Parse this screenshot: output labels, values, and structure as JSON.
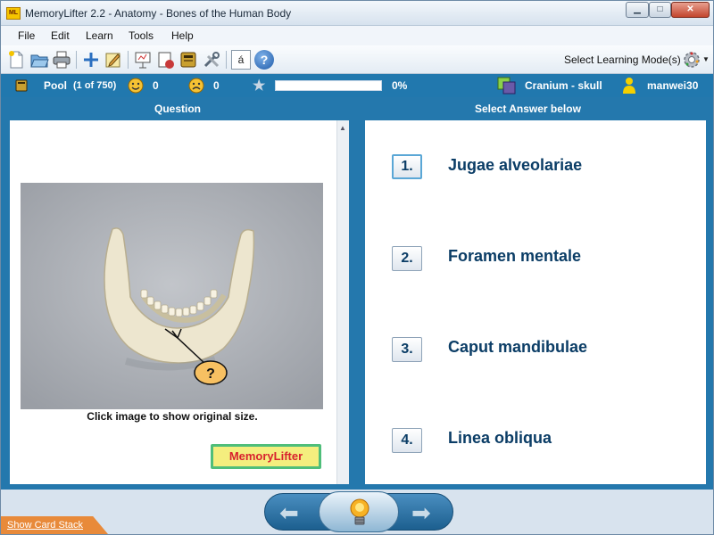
{
  "window": {
    "title": "MemoryLifter 2.2 - Anatomy - Bones of the Human Body",
    "app_icon_text": "ML"
  },
  "menu": [
    "File",
    "Edit",
    "Learn",
    "Tools",
    "Help"
  ],
  "toolbar": {
    "icons": [
      "new-document-icon",
      "open-folder-icon",
      "print-icon",
      "add-icon",
      "edit-card-icon",
      "presentation-icon",
      "print-cards-icon",
      "card-box-icon",
      "settings-tools-icon",
      "character-map-icon",
      "help-icon"
    ],
    "char_map_label": "á",
    "help_label": "?",
    "mode_label": "Select Learning Mode(s)"
  },
  "status": {
    "pool_label": "Pool",
    "pool_count": "(1 of 750)",
    "correct_count": "0",
    "wrong_count": "0",
    "progress_percent": 0,
    "progress_text": "0%",
    "chapter": "Cranium - skull",
    "user": "manwei30"
  },
  "question": {
    "header": "Question",
    "marker": "?",
    "caption": "Click image to show original size.",
    "logo_text": "MemoryLifter"
  },
  "answers": {
    "header": "Select Answer below",
    "items": [
      {
        "num": "1.",
        "text": "Jugae alveolariae"
      },
      {
        "num": "2.",
        "text": "Foramen mentale"
      },
      {
        "num": "3.",
        "text": "Caput mandibulae"
      },
      {
        "num": "4.",
        "text": "Linea obliqua"
      }
    ]
  },
  "bottom": {
    "show_card_stack": "Show Card Stack"
  },
  "colors": {
    "accent_blue": "#2478ad",
    "answer_text": "#0b3d66",
    "card_stack_tab": "#e88a3a"
  }
}
